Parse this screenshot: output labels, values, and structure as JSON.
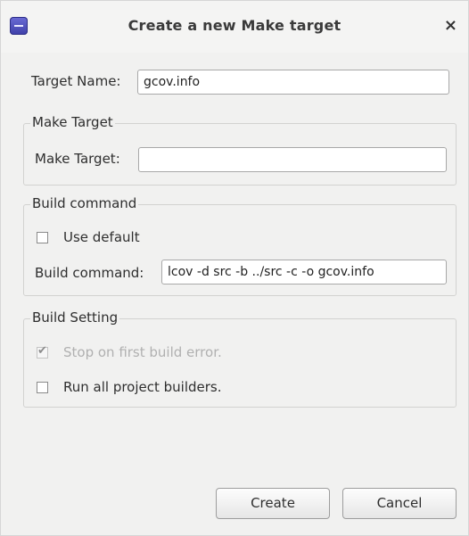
{
  "window": {
    "title": "Create a new Make target",
    "close_symbol": "×",
    "app_icon": "eclipse-icon"
  },
  "target_name": {
    "label": "Target Name:",
    "value": "gcov.info"
  },
  "make_target_group": {
    "legend": "Make Target",
    "label": "Make Target:",
    "value": ""
  },
  "build_command_group": {
    "legend": "Build command",
    "use_default_label": "Use default",
    "use_default_checked": false,
    "label": "Build command:",
    "value": "lcov -d src -b ../src -c -o gcov.info"
  },
  "build_setting_group": {
    "legend": "Build Setting",
    "stop_on_error_label": "Stop on first build error.",
    "stop_on_error_checked": true,
    "stop_on_error_enabled": false,
    "run_all_builders_label": "Run all project builders.",
    "run_all_builders_checked": false
  },
  "buttons": {
    "create_label": "Create",
    "cancel_label": "Cancel"
  }
}
